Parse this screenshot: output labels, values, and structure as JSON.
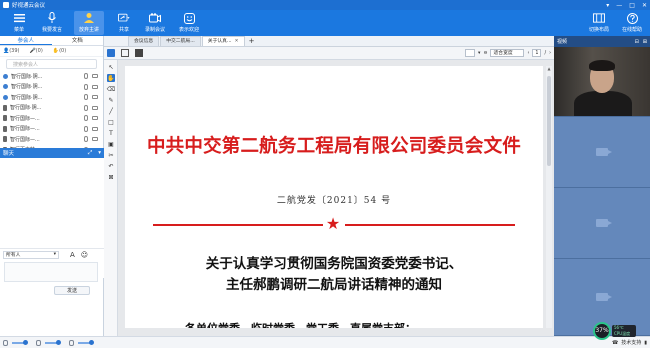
{
  "window": {
    "title": "好视通云会议",
    "controls": [
      "▾",
      "—",
      "□",
      "✕"
    ]
  },
  "toolbar": {
    "items": [
      {
        "label": "菜单",
        "icon": "menu-icon"
      },
      {
        "label": "我要发言",
        "icon": "microphone-icon"
      },
      {
        "label": "放弃主讲",
        "icon": "presenter-icon"
      },
      {
        "label": "共享",
        "icon": "share-icon"
      },
      {
        "label": "录制会议",
        "icon": "record-icon"
      },
      {
        "label": "表示欢迎",
        "icon": "emoji-icon"
      },
      {
        "label": "切换布局",
        "icon": "layout-icon"
      },
      {
        "label": "在线帮助",
        "icon": "help-icon"
      }
    ]
  },
  "left_panel": {
    "tabs": [
      "参会人",
      "文档"
    ],
    "counts": {
      "people": "(39)",
      "mic": "(0)",
      "hand": "(0)"
    },
    "search_placeholder": "搜索参会人",
    "participants": [
      {
        "name": "智行国际·阴..."
      },
      {
        "name": "智行国际·阴..."
      },
      {
        "name": "智行国际·阴..."
      },
      {
        "name": "智行国际·阴..."
      },
      {
        "name": "智行国际—..."
      },
      {
        "name": "智行国际—..."
      },
      {
        "name": "智行国际—..."
      },
      {
        "name": "智行百立特"
      }
    ]
  },
  "chat": {
    "header": "聊天",
    "recipient": "所有人",
    "send_label": "发送"
  },
  "doc_tabs": {
    "tabs": [
      {
        "label": "会议信息",
        "closable": false
      },
      {
        "label": "中交二航局...",
        "closable": false
      },
      {
        "label": "关于认真...",
        "closable": true
      }
    ],
    "add": "+"
  },
  "doc_toolbar": {
    "zoom": "适合宽度",
    "page": "1",
    "page_total": "/"
  },
  "document": {
    "title": "中共中交第二航务工程局有限公司委员会文件",
    "number": "二航党发〔2021〕54 号",
    "star": "★",
    "subject_line1": "关于认真学习贯彻国务院国资委党委书记、",
    "subject_line2": "主任郝鹏调研二航局讲话精神的通知",
    "addressee": "各单位党委、临时党委、党工委、直属党支部："
  },
  "video_panel": {
    "header": "视频",
    "controls": [
      "⊟",
      "⊞"
    ]
  },
  "status": {
    "tech_support": "技术支持",
    "cpu_percent": "37%",
    "temp": "56℃",
    "cpu_label": "CPU温度"
  }
}
